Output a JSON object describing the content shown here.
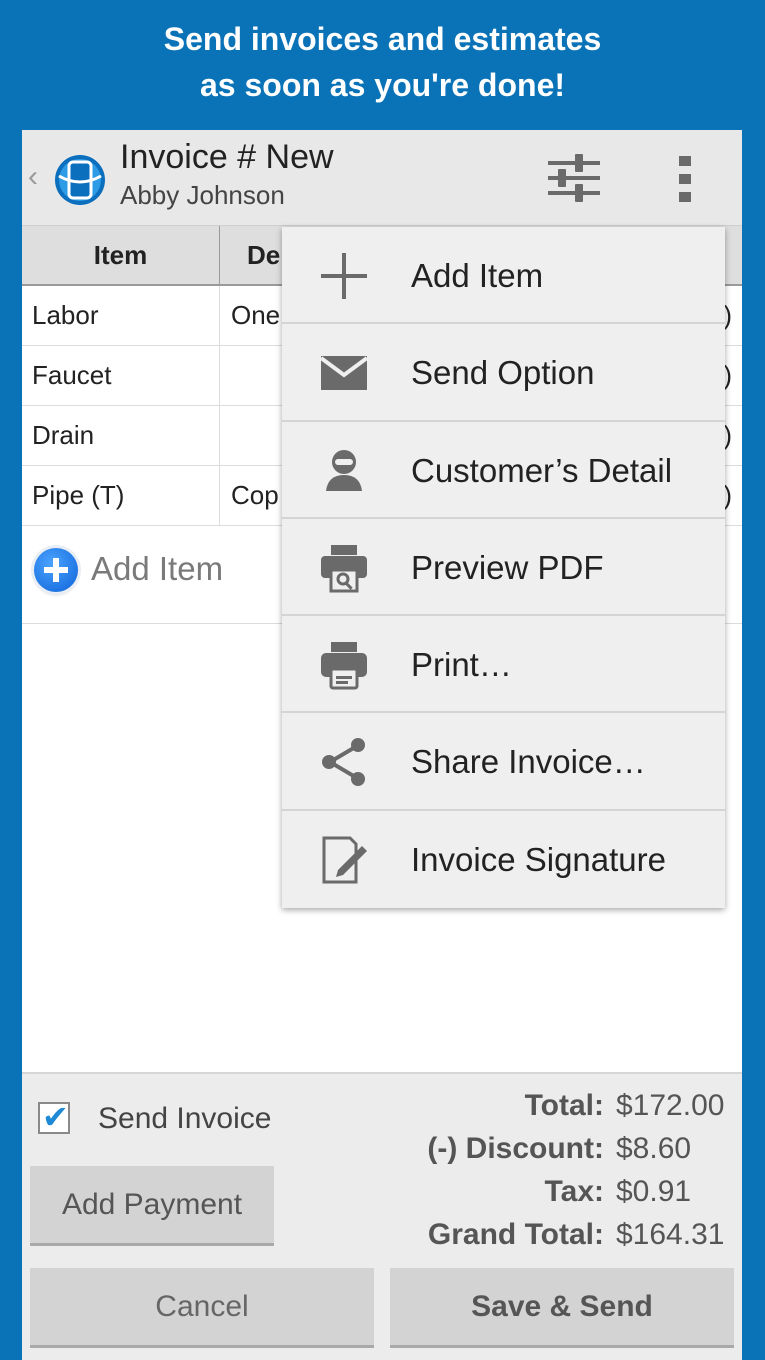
{
  "banner": {
    "line1": "Send invoices and estimates",
    "line2": "as soon as you're done!"
  },
  "header": {
    "title": "Invoice # New",
    "subtitle": "Abby Johnson",
    "back_glyph": "‹",
    "icons": [
      "app-logo-icon",
      "sliders-icon",
      "overflow-menu-icon"
    ]
  },
  "table": {
    "headers": [
      "Item",
      "De"
    ],
    "rows": [
      {
        "item": "Labor",
        "desc": "One",
        "amount": ")"
      },
      {
        "item": "Faucet",
        "desc": "",
        "amount": ")"
      },
      {
        "item": "Drain",
        "desc": "",
        "amount": ")"
      },
      {
        "item": "Pipe (T)",
        "desc": "Cop",
        "amount": ")"
      }
    ]
  },
  "add_item": {
    "label": "Add Item"
  },
  "menu": {
    "items": [
      {
        "label": "Add Item",
        "icon": "plus-icon"
      },
      {
        "label": "Send Option",
        "icon": "envelope-icon"
      },
      {
        "label": "Customer’s Detail",
        "icon": "person-icon"
      },
      {
        "label": "Preview PDF",
        "icon": "print-preview-icon"
      },
      {
        "label": "Print…",
        "icon": "printer-icon"
      },
      {
        "label": "Share Invoice…",
        "icon": "share-icon"
      },
      {
        "label": "Invoice Signature",
        "icon": "signature-icon"
      }
    ]
  },
  "bottom": {
    "send_invoice_label": "Send Invoice",
    "send_invoice_checked": true,
    "add_payment_label": "Add Payment",
    "cancel_label": "Cancel",
    "save_send_label": "Save & Send",
    "totals": [
      {
        "label": "Total:",
        "value": "$172.00"
      },
      {
        "label": "(-) Discount:",
        "value": "$8.60"
      },
      {
        "label": "Tax:",
        "value": "$0.91"
      },
      {
        "label": "Grand Total:",
        "value": "$164.31"
      }
    ]
  },
  "colors": {
    "background": "#0a73b7",
    "accent": "#1e8ad6",
    "menu_bg": "#efefef"
  }
}
